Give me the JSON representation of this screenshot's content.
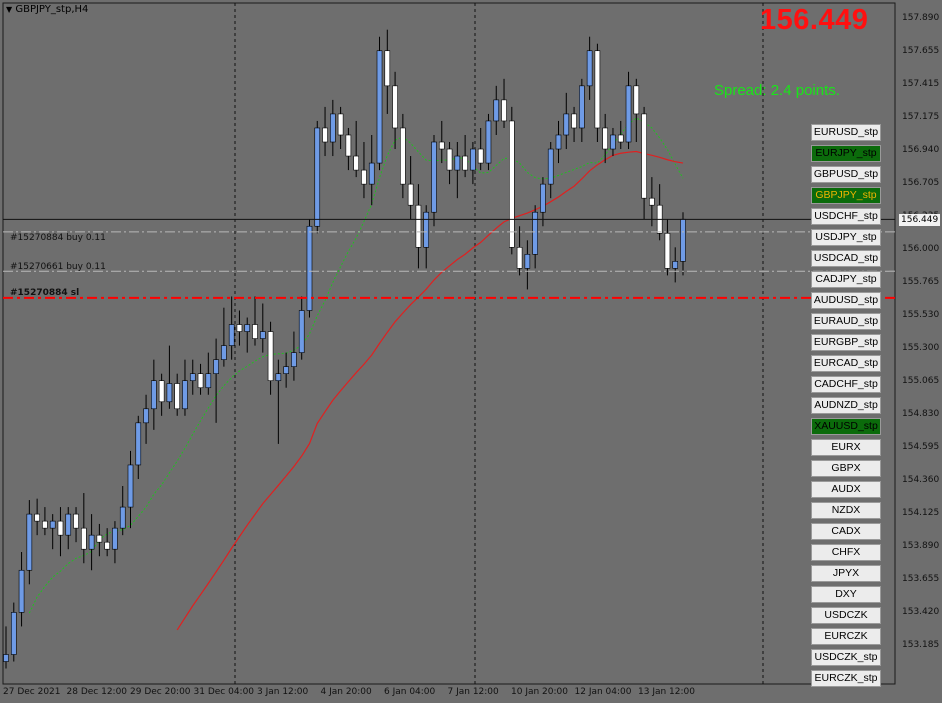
{
  "window": {
    "title": "GBPJPY_stp,H4"
  },
  "current_price": "156.449",
  "spread_text": "Spread: 2.4 points.",
  "orders": [
    {
      "label": "#15270884 buy 0.11",
      "price": 156.36
    },
    {
      "label": "#15270661 buy 0.11",
      "price": 156.08
    },
    {
      "label": "#15270884 sl",
      "price": 155.89
    }
  ],
  "symbol_buttons": [
    {
      "label": "EURUSD_stp",
      "state": "normal"
    },
    {
      "label": "EURJPY_stp",
      "state": "active"
    },
    {
      "label": "GBPUSD_stp",
      "state": "normal"
    },
    {
      "label": "GBPJPY_stp",
      "state": "current"
    },
    {
      "label": "USDCHF_stp",
      "state": "normal"
    },
    {
      "label": "USDJPY_stp",
      "state": "normal"
    },
    {
      "label": "USDCAD_stp",
      "state": "normal"
    },
    {
      "label": "CADJPY_stp",
      "state": "normal"
    },
    {
      "label": "AUDUSD_stp",
      "state": "normal"
    },
    {
      "label": "EURAUD_stp",
      "state": "normal"
    },
    {
      "label": "EURGBP_stp",
      "state": "normal"
    },
    {
      "label": "EURCAD_stp",
      "state": "normal"
    },
    {
      "label": "CADCHF_stp",
      "state": "normal"
    },
    {
      "label": "AUDNZD_stp",
      "state": "normal"
    },
    {
      "label": "XAUUSD_stp",
      "state": "active"
    },
    {
      "label": "EURX",
      "state": "normal"
    },
    {
      "label": "GBPX",
      "state": "normal"
    },
    {
      "label": "AUDX",
      "state": "normal"
    },
    {
      "label": "NZDX",
      "state": "normal"
    },
    {
      "label": "CADX",
      "state": "normal"
    },
    {
      "label": "CHFX",
      "state": "normal"
    },
    {
      "label": "JPYX",
      "state": "normal"
    },
    {
      "label": "DXY",
      "state": "normal"
    },
    {
      "label": "USDCZK",
      "state": "normal"
    },
    {
      "label": "EURCZK",
      "state": "normal"
    },
    {
      "label": "USDCZK_stp",
      "state": "normal"
    },
    {
      "label": "EURCZK_stp",
      "state": "normal"
    }
  ],
  "price_axis": [
    "157.890",
    "157.655",
    "157.415",
    "157.175",
    "156.940",
    "156.705",
    "156.235",
    "156.000",
    "155.765",
    "155.530",
    "155.300",
    "155.065",
    "154.830",
    "154.595",
    "154.360",
    "154.125",
    "153.890",
    "153.655",
    "153.420",
    "153.185"
  ],
  "time_axis": [
    "27 Dec 2021",
    "28 Dec 12:00",
    "29 Dec 20:00",
    "31 Dec 04:00",
    "3 Jan 12:00",
    "4 Jan 20:00",
    "6 Jan 04:00",
    "7 Jan 12:00",
    "10 Jan 20:00",
    "12 Jan 04:00",
    "13 Jan 12:00"
  ],
  "colors": {
    "background": "#6e6e6e",
    "bull": "#6f9be6",
    "bear": "#ffffff",
    "ma_slow": "#e02020",
    "ma_fast": "#20c020",
    "sl_line": "#ff0000"
  },
  "chart_data": {
    "type": "candlestick",
    "symbol": "GBPJPY_stp",
    "timeframe": "H4",
    "y_range": [
      153.14,
      157.99
    ],
    "candles": [
      [
        153.3,
        153.55,
        153.25,
        153.35
      ],
      [
        153.35,
        153.72,
        153.3,
        153.65
      ],
      [
        153.65,
        154.08,
        153.55,
        153.95
      ],
      [
        153.95,
        154.45,
        153.85,
        154.35
      ],
      [
        154.35,
        154.46,
        154.2,
        154.3
      ],
      [
        154.3,
        154.4,
        154.2,
        154.25
      ],
      [
        154.25,
        154.35,
        154.1,
        154.3
      ],
      [
        154.3,
        154.4,
        154.05,
        154.2
      ],
      [
        154.2,
        154.4,
        154.1,
        154.35
      ],
      [
        154.35,
        154.4,
        154.15,
        154.25
      ],
      [
        154.25,
        154.5,
        154.0,
        154.1
      ],
      [
        154.1,
        154.35,
        153.95,
        154.2
      ],
      [
        154.2,
        154.28,
        154.05,
        154.15
      ],
      [
        154.15,
        154.25,
        154.05,
        154.1
      ],
      [
        154.1,
        154.3,
        154.0,
        154.25
      ],
      [
        154.25,
        154.55,
        154.2,
        154.4
      ],
      [
        154.4,
        154.8,
        154.25,
        154.7
      ],
      [
        154.7,
        155.05,
        154.6,
        155.0
      ],
      [
        155.0,
        155.2,
        154.85,
        155.1
      ],
      [
        155.1,
        155.45,
        154.95,
        155.3
      ],
      [
        155.3,
        155.35,
        155.05,
        155.15
      ],
      [
        155.15,
        155.55,
        155.1,
        155.28
      ],
      [
        155.28,
        155.35,
        155.05,
        155.1
      ],
      [
        155.1,
        155.45,
        155.05,
        155.3
      ],
      [
        155.3,
        155.45,
        155.2,
        155.35
      ],
      [
        155.35,
        155.42,
        155.2,
        155.25
      ],
      [
        155.25,
        155.5,
        155.2,
        155.35
      ],
      [
        155.35,
        155.6,
        155.0,
        155.45
      ],
      [
        155.45,
        155.82,
        155.4,
        155.55
      ],
      [
        155.55,
        155.9,
        155.45,
        155.7
      ],
      [
        155.7,
        155.8,
        155.55,
        155.65
      ],
      [
        155.65,
        155.75,
        155.5,
        155.7
      ],
      [
        155.7,
        155.9,
        155.55,
        155.6
      ],
      [
        155.6,
        155.85,
        155.5,
        155.65
      ],
      [
        155.65,
        155.72,
        155.2,
        155.3
      ],
      [
        155.3,
        155.45,
        154.85,
        155.35
      ],
      [
        155.35,
        155.5,
        155.25,
        155.4
      ],
      [
        155.4,
        155.65,
        155.3,
        155.5
      ],
      [
        155.5,
        155.9,
        155.45,
        155.8
      ],
      [
        155.8,
        156.45,
        155.75,
        156.4
      ],
      [
        156.4,
        157.15,
        156.35,
        157.1
      ],
      [
        157.1,
        157.25,
        156.9,
        157.0
      ],
      [
        157.0,
        157.3,
        156.9,
        157.2
      ],
      [
        157.2,
        157.25,
        156.95,
        157.05
      ],
      [
        157.05,
        157.1,
        156.8,
        156.9
      ],
      [
        156.9,
        157.15,
        156.75,
        156.8
      ],
      [
        156.8,
        157.0,
        156.6,
        156.7
      ],
      [
        156.7,
        157.05,
        156.55,
        156.85
      ],
      [
        156.85,
        157.75,
        156.8,
        157.65
      ],
      [
        157.65,
        157.8,
        157.2,
        157.4
      ],
      [
        157.4,
        157.5,
        156.95,
        157.1
      ],
      [
        157.1,
        157.2,
        156.6,
        156.7
      ],
      [
        156.7,
        156.9,
        156.45,
        156.55
      ],
      [
        156.55,
        156.7,
        156.1,
        156.25
      ],
      [
        156.25,
        156.55,
        156.1,
        156.5
      ],
      [
        156.5,
        157.05,
        156.4,
        157.0
      ],
      [
        157.0,
        157.15,
        156.85,
        156.95
      ],
      [
        156.95,
        157.0,
        156.7,
        156.8
      ],
      [
        156.8,
        157.0,
        156.6,
        156.9
      ],
      [
        156.9,
        157.05,
        156.75,
        156.8
      ],
      [
        156.8,
        157.0,
        156.7,
        156.95
      ],
      [
        156.95,
        157.1,
        156.8,
        156.85
      ],
      [
        156.85,
        157.2,
        156.8,
        157.15
      ],
      [
        157.15,
        157.4,
        157.05,
        157.3
      ],
      [
        157.3,
        157.45,
        157.1,
        157.15
      ],
      [
        157.15,
        157.25,
        156.2,
        156.25
      ],
      [
        156.25,
        156.4,
        156.05,
        156.1
      ],
      [
        156.1,
        156.3,
        155.95,
        156.2
      ],
      [
        156.2,
        156.55,
        156.1,
        156.5
      ],
      [
        156.5,
        156.75,
        156.4,
        156.7
      ],
      [
        156.7,
        157.0,
        156.6,
        156.95
      ],
      [
        156.95,
        157.15,
        156.85,
        157.05
      ],
      [
        157.05,
        157.35,
        156.95,
        157.2
      ],
      [
        157.2,
        157.25,
        157.0,
        157.1
      ],
      [
        157.1,
        157.45,
        157.0,
        157.4
      ],
      [
        157.4,
        157.75,
        157.3,
        157.65
      ],
      [
        157.65,
        157.7,
        157.0,
        157.1
      ],
      [
        157.1,
        157.2,
        156.85,
        156.95
      ],
      [
        156.95,
        157.1,
        156.9,
        157.05
      ],
      [
        157.05,
        157.15,
        156.95,
        157.0
      ],
      [
        157.0,
        157.5,
        156.95,
        157.4
      ],
      [
        157.4,
        157.45,
        157.0,
        157.2
      ],
      [
        157.2,
        157.25,
        156.45,
        156.6
      ],
      [
        156.6,
        156.75,
        156.4,
        156.55
      ],
      [
        156.55,
        156.7,
        156.3,
        156.35
      ],
      [
        156.35,
        156.45,
        156.05,
        156.1
      ],
      [
        156.1,
        156.25,
        156.0,
        156.15
      ],
      [
        156.15,
        156.5,
        156.05,
        156.45
      ]
    ],
    "overlays": [
      {
        "name": "ma_fast",
        "style": "dotted",
        "color": "#20c020"
      },
      {
        "name": "ma_slow",
        "style": "solid",
        "color": "#e02020"
      }
    ]
  }
}
